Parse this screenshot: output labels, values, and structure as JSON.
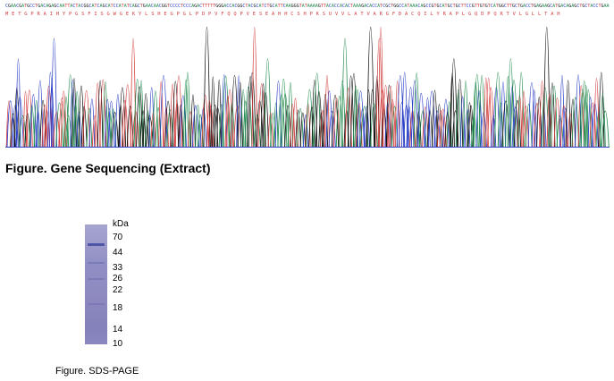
{
  "sequencing": {
    "protein_sequence": "METGPRAIHYPGSFISGWGEKYLSHEGPGLPDPVFQQPVESEAHHCSHPKSUVVLATVARGFDACQILYRAPLGQDPQRTVLGLLTAH"
  },
  "figure1": {
    "caption": "Figure. Gene Sequencing (Extract)"
  },
  "gel": {
    "unit": "kDa",
    "markers": [
      "70",
      "44",
      "33",
      "26",
      "22",
      "18",
      "14",
      "10"
    ]
  },
  "figure2": {
    "caption": "Figure. SDS-PAGE"
  },
  "colors": {
    "trace_a": "#1f8a4c",
    "trace_c": "#2b3fc7",
    "trace_g": "#111111",
    "trace_t": "#d23c3c",
    "gel_lane": "#8f8ec4",
    "gel_band": "#4f55a8"
  }
}
